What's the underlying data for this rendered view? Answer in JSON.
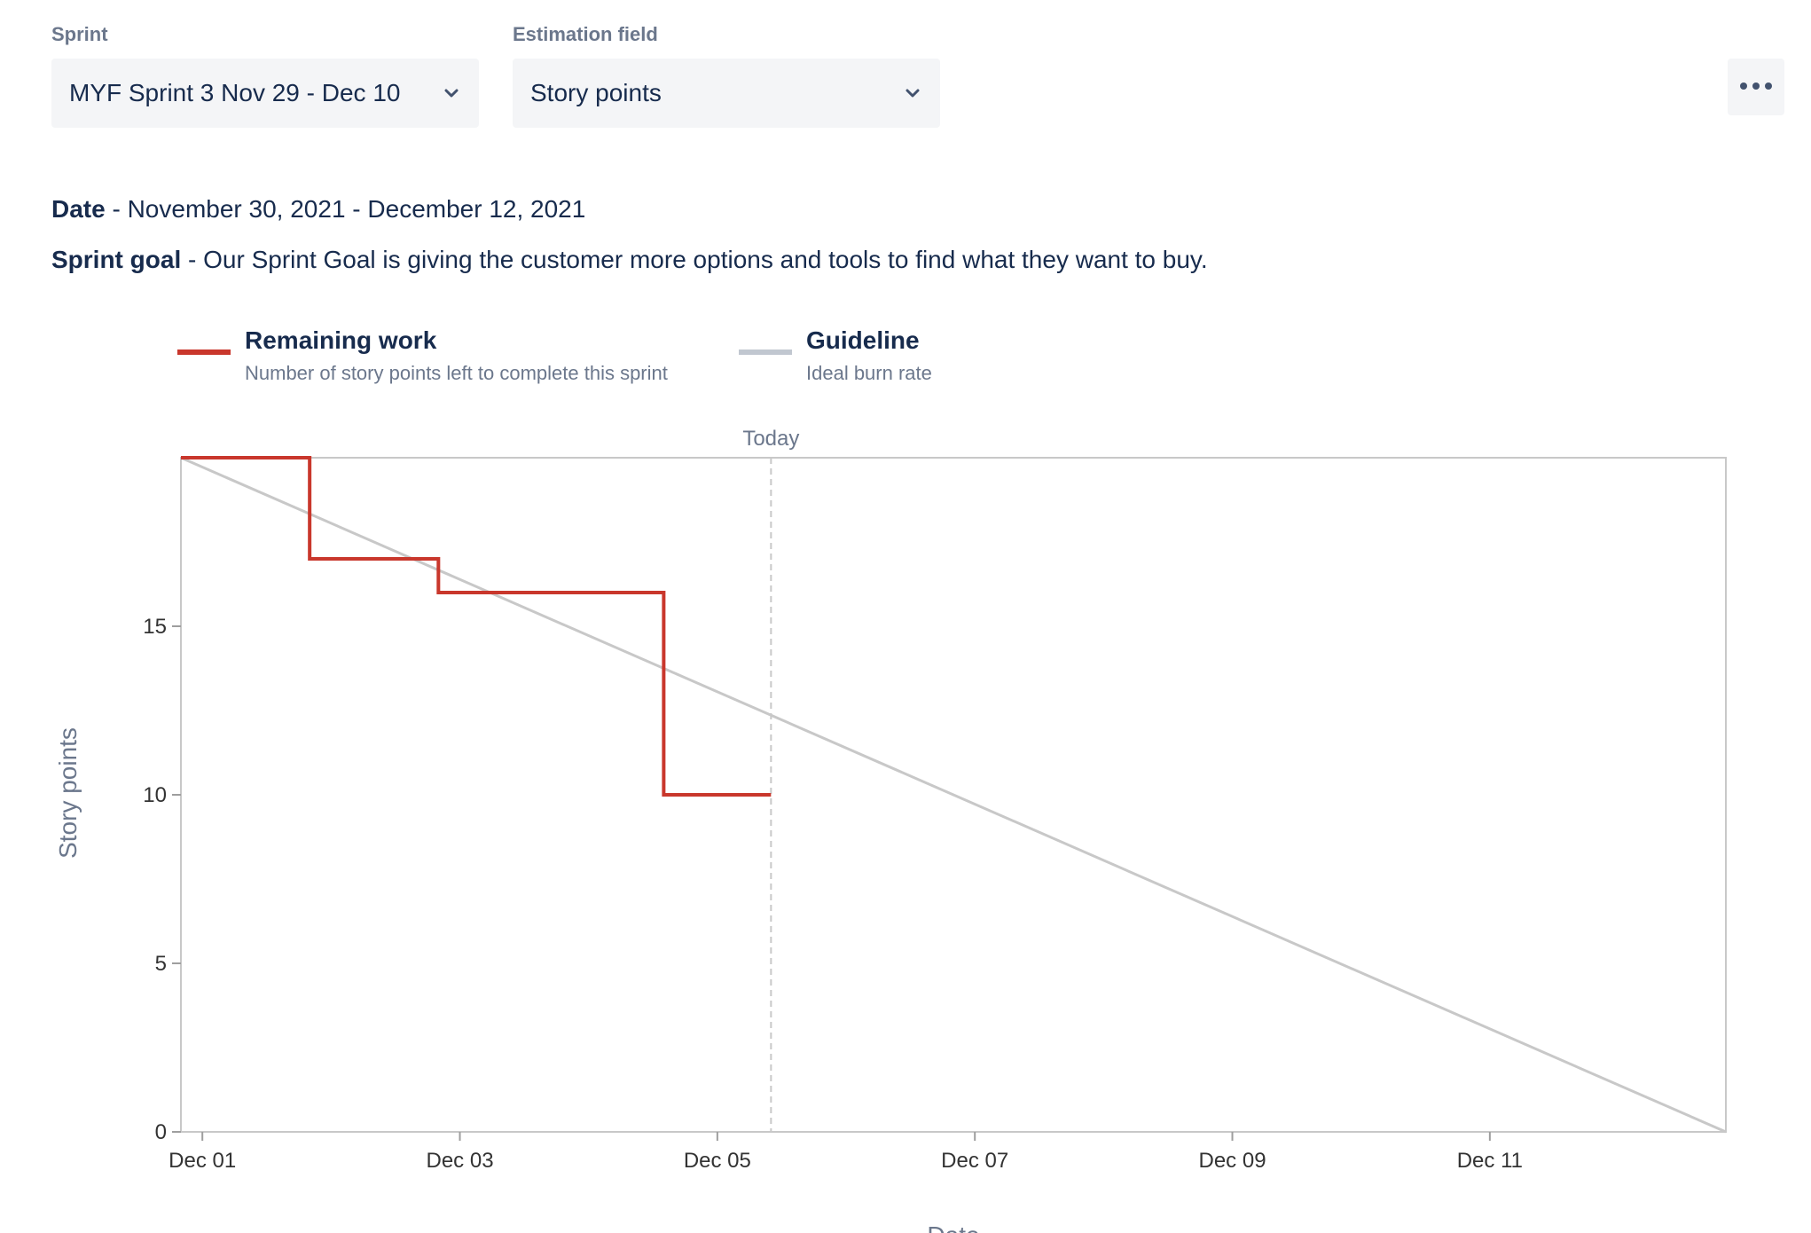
{
  "controls": {
    "sprint_label": "Sprint",
    "sprint_value": "MYF Sprint 3 Nov 29 - Dec 10",
    "estimation_label": "Estimation field",
    "estimation_value": "Story points",
    "icons": {
      "dropdown": "chevron-down-icon",
      "more": "more-horizontal-icon"
    }
  },
  "info": {
    "date_label": "Date",
    "date_value": " - November 30, 2021 - December 12, 2021",
    "goal_label": "Sprint goal",
    "goal_value": " - Our Sprint Goal is giving the customer more options and tools to find what they want to buy."
  },
  "legend": [
    {
      "title": "Remaining work",
      "subtitle": "Number of story points left to complete this sprint",
      "color": "#C9372C"
    },
    {
      "title": "Guideline",
      "subtitle": "Ideal burn rate",
      "color": "#C1C7D0"
    }
  ],
  "chart_data": {
    "type": "line",
    "xlabel": "Date",
    "ylabel": "Story points",
    "x_ticks": [
      "Dec 01",
      "Dec 03",
      "Dec 05",
      "Dec 07",
      "Dec 09",
      "Dec 11"
    ],
    "y_ticks": [
      0,
      5,
      10,
      15
    ],
    "xlim": [
      "2021-11-30T20:00",
      "2021-12-12T20:00"
    ],
    "ylim": [
      0,
      20
    ],
    "today": {
      "label": "Today",
      "x": "2021-12-05T10:00"
    },
    "series": [
      {
        "name": "Remaining work",
        "style": "step",
        "color": "#C9372C",
        "points": [
          {
            "x": "2021-11-30T20:00",
            "y": 20
          },
          {
            "x": "2021-12-01T20:00",
            "y": 17
          },
          {
            "x": "2021-12-02T20:00",
            "y": 16
          },
          {
            "x": "2021-12-04T14:00",
            "y": 10
          },
          {
            "x": "2021-12-05T10:00",
            "y": 10
          }
        ]
      },
      {
        "name": "Guideline",
        "style": "line",
        "color": "#C8C8C8",
        "points": [
          {
            "x": "2021-11-30T20:00",
            "y": 20
          },
          {
            "x": "2021-12-12T20:00",
            "y": 0
          }
        ]
      }
    ]
  }
}
